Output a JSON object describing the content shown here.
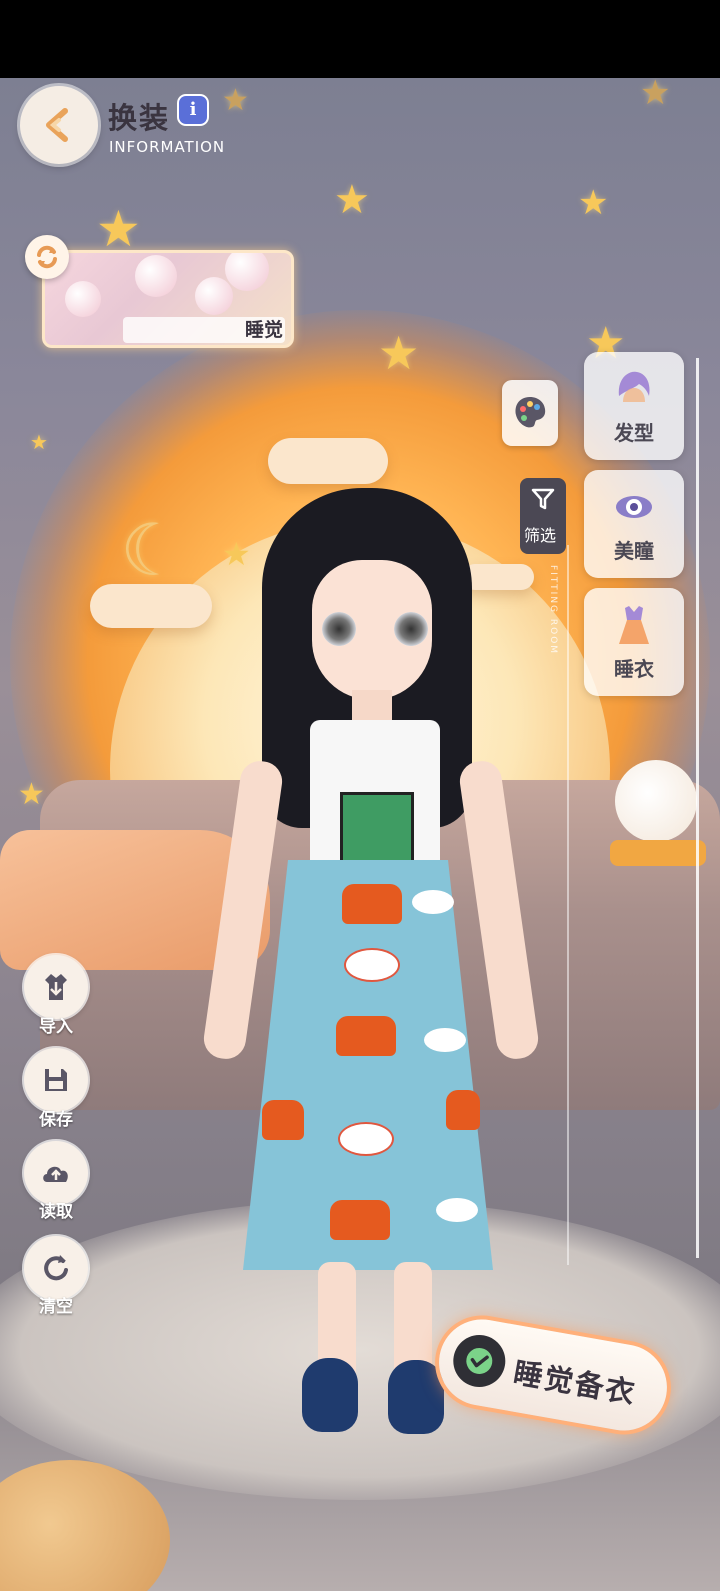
{
  "header": {
    "title": "换装",
    "info_icon": "i",
    "subtitle": "INFORMATION"
  },
  "scene_card": {
    "label": "睡觉"
  },
  "toolbar": {
    "filter_label": "筛选",
    "fitting_room_text": "FITTING ROOM"
  },
  "categories": [
    {
      "label": "发型",
      "icon": "hairstyle-icon"
    },
    {
      "label": "美瞳",
      "icon": "contact-lens-icon"
    },
    {
      "label": "睡衣",
      "icon": "pajamas-icon"
    }
  ],
  "side_actions": [
    {
      "label": "导入",
      "icon": "import-icon"
    },
    {
      "label": "保存",
      "icon": "save-icon"
    },
    {
      "label": "读取",
      "icon": "load-icon"
    },
    {
      "label": "清空",
      "icon": "clear-icon"
    }
  ],
  "confirm": {
    "label": "睡觉备衣"
  },
  "colors": {
    "accent_orange": "#ffb07a",
    "title_text": "#3a3440",
    "info_badge": "#5a6fd8"
  }
}
